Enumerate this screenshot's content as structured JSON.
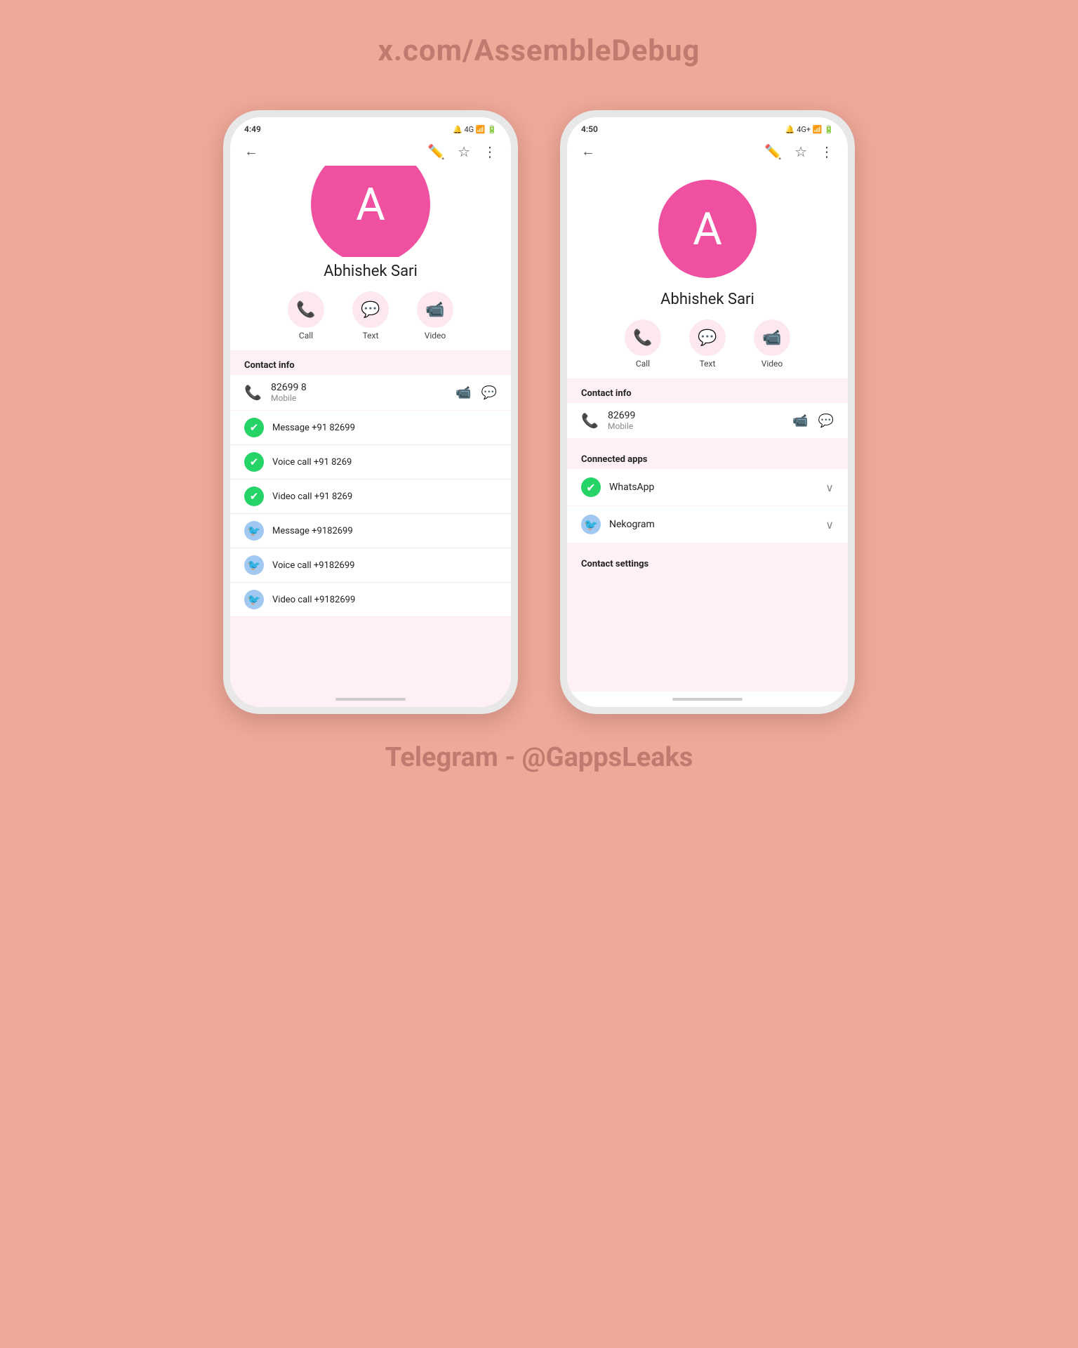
{
  "header": {
    "title": "x.com/AssembleDebug"
  },
  "footer": {
    "telegram": "Telegram - @GappsLeaks"
  },
  "phone1": {
    "status": {
      "time": "4:49",
      "icons": "🔔 4G 📶 🔋"
    },
    "contact_name": "Abhishek Sari",
    "actions": {
      "call": "Call",
      "text": "Text",
      "video": "Video"
    },
    "contact_info_label": "Contact info",
    "phone_number": "82699 8",
    "phone_type": "Mobile",
    "list_items": [
      {
        "app": "whatsapp",
        "label": "Message +91 82699"
      },
      {
        "app": "whatsapp",
        "label": "Voice call +91 8269"
      },
      {
        "app": "whatsapp",
        "label": "Video call +91 8269"
      },
      {
        "app": "nekogram",
        "label": "Message +9182699"
      },
      {
        "app": "nekogram",
        "label": "Voice call +9182699"
      },
      {
        "app": "nekogram",
        "label": "Video call +9182699"
      }
    ]
  },
  "phone2": {
    "status": {
      "time": "4:50",
      "icons": "🔔 4G+ 📶 🔋"
    },
    "contact_name": "Abhishek Sari",
    "actions": {
      "call": "Call",
      "text": "Text",
      "video": "Video"
    },
    "contact_info_label": "Contact info",
    "phone_number": "82699",
    "phone_type": "Mobile",
    "connected_apps_label": "Connected apps",
    "apps": [
      {
        "name": "WhatsApp",
        "type": "whatsapp"
      },
      {
        "name": "Nekogram",
        "type": "nekogram"
      }
    ],
    "contact_settings_label": "Contact settings"
  }
}
